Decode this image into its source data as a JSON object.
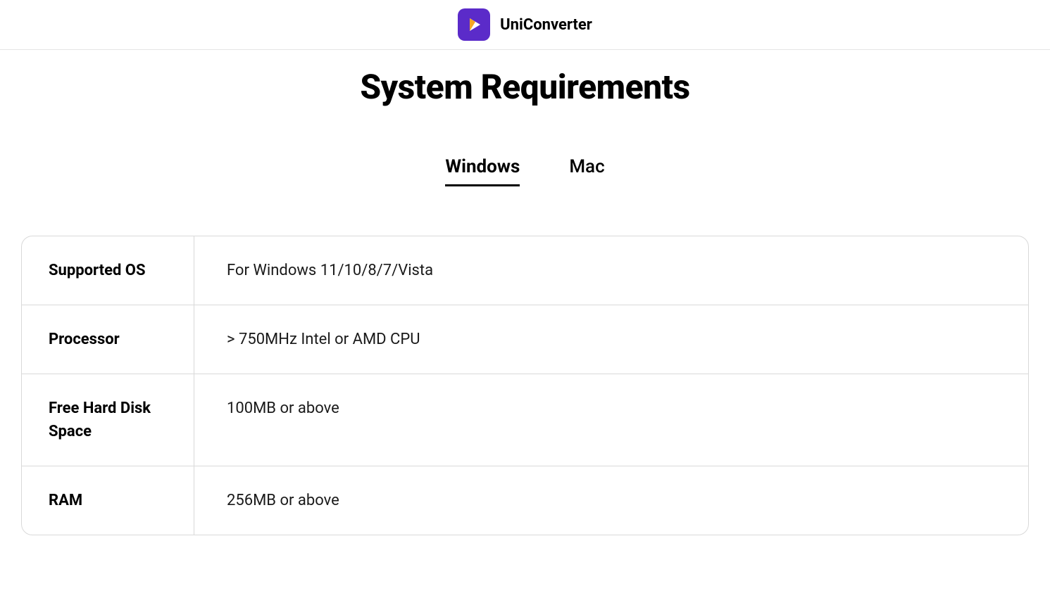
{
  "brand": {
    "name": "UniConverter"
  },
  "title": "System Requirements",
  "tabs": [
    {
      "label": "Windows",
      "active": true
    },
    {
      "label": "Mac",
      "active": false
    }
  ],
  "requirements": [
    {
      "label": "Supported OS",
      "value": "For Windows 11/10/8/7/Vista"
    },
    {
      "label": "Processor",
      "value": "> 750MHz Intel or AMD CPU"
    },
    {
      "label": "Free Hard Disk Space",
      "value": "100MB or above"
    },
    {
      "label": "RAM",
      "value": "256MB or above"
    }
  ]
}
